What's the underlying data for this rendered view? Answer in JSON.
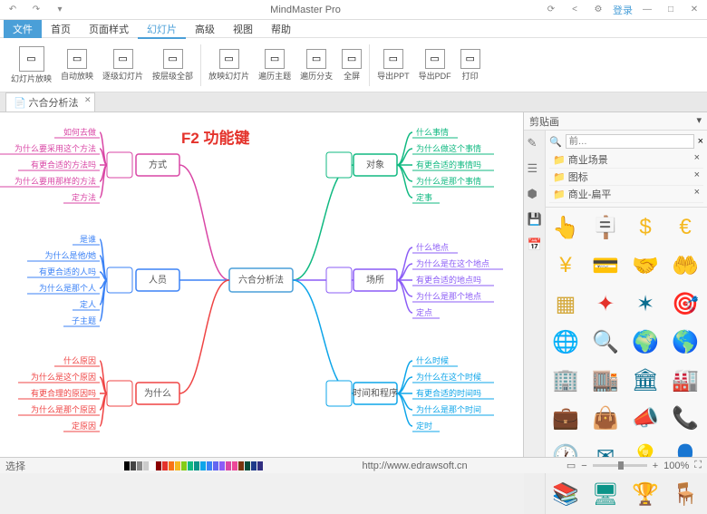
{
  "titlebar": {
    "title": "MindMaster Pro",
    "login": "登录"
  },
  "menu": {
    "file": "文件",
    "items": [
      "首页",
      "页面样式",
      "幻灯片",
      "高级",
      "视图",
      "帮助"
    ],
    "activeIndex": 2
  },
  "ribbon": [
    {
      "label": "幻灯片放映",
      "big": true
    },
    {
      "label": "自动放映"
    },
    {
      "label": "逐级幻灯片"
    },
    {
      "label": "按层级全部"
    },
    {
      "sep": true
    },
    {
      "label": "放映幻灯片"
    },
    {
      "label": "遍历主题"
    },
    {
      "label": "遍历分支"
    },
    {
      "label": "全屏"
    },
    {
      "sep": true
    },
    {
      "label": "导出PPT"
    },
    {
      "label": "导出PDF"
    },
    {
      "label": "打印"
    }
  ],
  "doctab": {
    "name": "六合分析法"
  },
  "annotation": "F2 功能键",
  "mind": {
    "root": "六合分析法",
    "left": [
      {
        "title": "方式",
        "color": "#d946a5",
        "icon": "people",
        "leaves": [
          "如何去做",
          "为什么要采用这个方法",
          "有更合适的方法吗",
          "为什么要用那样的方法",
          "定方法"
        ]
      },
      {
        "title": "人员",
        "color": "#3b82f6",
        "icon": "network",
        "leaves": [
          "是谁",
          "为什么是他/她",
          "有更合适的人吗",
          "为什么是那个人",
          "定人",
          "子主题"
        ]
      },
      {
        "title": "为什么",
        "color": "#ef4444",
        "icon": "question",
        "leaves": [
          "什么原因",
          "为什么是这个原因",
          "有更合理的原因吗",
          "为什么是那个原因",
          "定原因"
        ]
      }
    ],
    "right": [
      {
        "title": "对象",
        "color": "#10b981",
        "icon": "chart",
        "leaves": [
          "什么事情",
          "为什么做这个事情",
          "有更合适的事情吗",
          "为什么是那个事情",
          "定事"
        ]
      },
      {
        "title": "场所",
        "color": "#8b5cf6",
        "icon": "place",
        "leaves": [
          "什么地点",
          "为什么是在这个地点",
          "有更合适的地点吗",
          "为什么是那个地点",
          "定点"
        ]
      },
      {
        "title": "时间和程序",
        "color": "#0ea5e9",
        "icon": "clock",
        "leaves": [
          "什么时候",
          "为什么在这个时候",
          "有更合适的时间吗",
          "为什么是那个时间",
          "定时"
        ]
      }
    ]
  },
  "side": {
    "header": "剪贴画",
    "search_ph": "前…",
    "cats": [
      "商业场景",
      "图标",
      "商业-扁平"
    ],
    "icons": [
      {
        "c": "#d4a83a",
        "g": "👆"
      },
      {
        "c": "#d4a83a",
        "g": "🪧"
      },
      {
        "c": "#f5b820",
        "g": "$"
      },
      {
        "c": "#f5b820",
        "g": "€"
      },
      {
        "c": "#f5b820",
        "g": "¥"
      },
      {
        "c": "#0b6e8f",
        "g": "💳"
      },
      {
        "c": "#d4a83a",
        "g": "🤝"
      },
      {
        "c": "#0b6e8f",
        "g": "🤲"
      },
      {
        "c": "#d4a83a",
        "g": "▦"
      },
      {
        "c": "#e4322b",
        "g": "✦"
      },
      {
        "c": "#0b6e8f",
        "g": "✶"
      },
      {
        "c": "#e4322b",
        "g": "🎯"
      },
      {
        "c": "#0b9488",
        "g": "🌐"
      },
      {
        "c": "#0b6e8f",
        "g": "🔍"
      },
      {
        "c": "#0b6e8f",
        "g": "🌍"
      },
      {
        "c": "#0b9488",
        "g": "🌎"
      },
      {
        "c": "#0b6e8f",
        "g": "🏢"
      },
      {
        "c": "#0b9488",
        "g": "🏬"
      },
      {
        "c": "#0b6e8f",
        "g": "🏛"
      },
      {
        "c": "#0b6e8f",
        "g": "🏭"
      },
      {
        "c": "#0b6e8f",
        "g": "💼"
      },
      {
        "c": "#f5b820",
        "g": "👜"
      },
      {
        "c": "#e4322b",
        "g": "📣"
      },
      {
        "c": "#e4322b",
        "g": "📞"
      },
      {
        "c": "#0b6e8f",
        "g": "🕐"
      },
      {
        "c": "#0b6e8f",
        "g": "✉"
      },
      {
        "c": "#f5b820",
        "g": "💡"
      },
      {
        "c": "#0b6e8f",
        "g": "👤"
      },
      {
        "c": "#d4a83a",
        "g": "📚"
      },
      {
        "c": "#0b9488",
        "g": "🖥"
      },
      {
        "c": "#d4a83a",
        "g": "🏆"
      },
      {
        "c": "#0b6e8f",
        "g": "🪑"
      }
    ]
  },
  "status": {
    "url": "http://www.edrawsoft.cn",
    "zoom": "100%"
  }
}
